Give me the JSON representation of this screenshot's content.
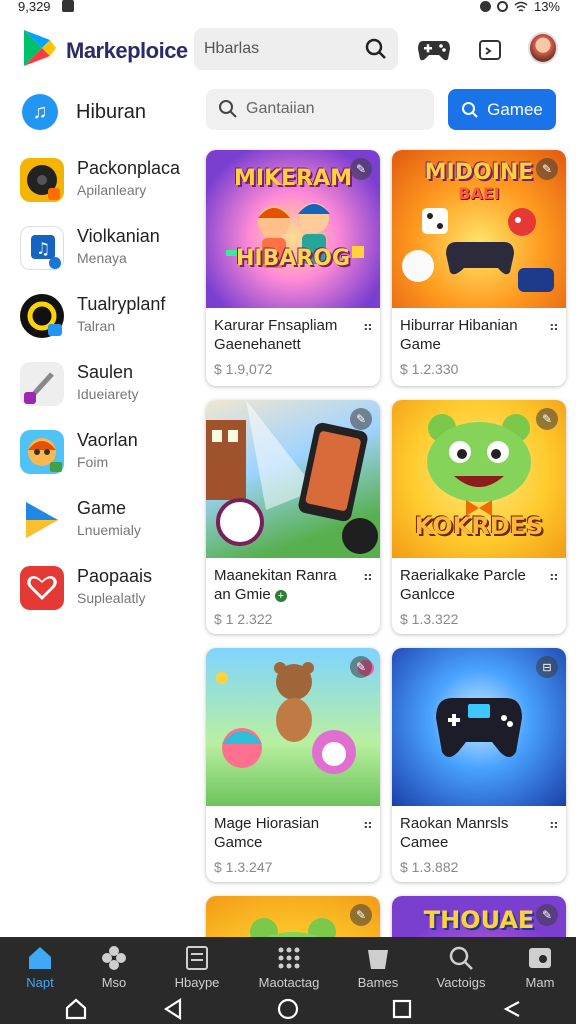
{
  "status": {
    "time": "9,329",
    "battery": "13%"
  },
  "header": {
    "brand": "Markeploice",
    "search_value": "Hbarlas"
  },
  "sidebar": {
    "header_label": "Hiburan",
    "items": [
      {
        "title": "Packonplaca",
        "subtitle": "Apilanleary",
        "icon": "app-icon",
        "color": "#f4b400"
      },
      {
        "title": "Violkanian",
        "subtitle": "Menaya",
        "icon": "music-icon",
        "color": "#ffffff"
      },
      {
        "title": "Tualryplanf",
        "subtitle": "Talran",
        "icon": "app-icon",
        "color": "#111111"
      },
      {
        "title": "Saulen",
        "subtitle": "Idueiarety",
        "icon": "pen-icon",
        "color": "#eeeeee"
      },
      {
        "title": "Vaorlan",
        "subtitle": "Foim",
        "icon": "face-icon",
        "color": "#f57c00"
      },
      {
        "title": "Game",
        "subtitle": "Lnuemialy",
        "icon": "play-icon",
        "color": "#ffffff"
      },
      {
        "title": "Paopaais",
        "subtitle": "Suplealatly",
        "icon": "heart-icon",
        "color": "#e53935"
      }
    ]
  },
  "main": {
    "search_placeholder": "Gantaiian",
    "games_button": "Gamee",
    "cards": [
      {
        "art_title": "MIKERAM",
        "art_title2": "HIBAROG",
        "name": "Karurar Fnsapliam Gaenehanett",
        "price": "$ 1.9,072"
      },
      {
        "art_title": "MIDOINE",
        "art_title2": "BAEI",
        "name": "Hiburrar Hibanian Game",
        "price": "$ 1.2.330"
      },
      {
        "art_title": "",
        "art_title2": "",
        "name": "Maanekitan Ranra an Gmie",
        "price": "$ 1 2.322"
      },
      {
        "art_title": "",
        "art_title2": "KOKRDES",
        "name": "Raerialkake Parcle Ganlcce",
        "price": "$ 1.3.322"
      },
      {
        "art_title": "",
        "art_title2": "",
        "name": "Mage Hiorasian Gamce",
        "price": "$ 1.3.247"
      },
      {
        "art_title": "",
        "art_title2": "",
        "name": "Raokan Manrsls Camee",
        "price": "$ 1.3.882"
      },
      {
        "art_title": "",
        "art_title2": "",
        "name": "",
        "price": ""
      },
      {
        "art_title": "THOUAE",
        "art_title2": "",
        "name": "",
        "price": ""
      }
    ]
  },
  "bottom_nav": [
    {
      "label": "Napt",
      "icon": "home-icon",
      "active": true
    },
    {
      "label": "Mso",
      "icon": "asterisk-icon",
      "active": false
    },
    {
      "label": "Hbaype",
      "icon": "document-icon",
      "active": false
    },
    {
      "label": "Maotactag",
      "icon": "grid-icon",
      "active": false
    },
    {
      "label": "Bames",
      "icon": "bucket-icon",
      "active": false
    },
    {
      "label": "Vactoigs",
      "icon": "search-icon",
      "active": false
    },
    {
      "label": "Mam",
      "icon": "image-icon",
      "active": false
    }
  ],
  "colors": {
    "accent": "#1a73e8",
    "nav_bg": "#2a2a2a",
    "nav_active": "#3fa9f5"
  }
}
